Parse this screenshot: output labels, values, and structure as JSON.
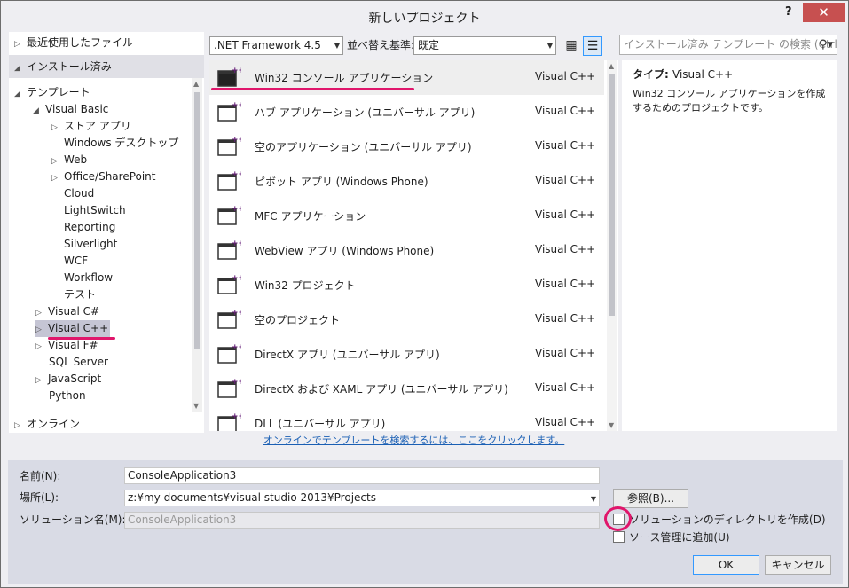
{
  "window": {
    "title": "新しいプロジェクト",
    "help": "?",
    "close": "✕"
  },
  "left_panel": {
    "recent": "最近使用したファイル",
    "installed": "インストール済み",
    "online": "オンライン",
    "tree": {
      "templates": "テンプレート",
      "visual_basic": "Visual Basic",
      "vb_children": [
        "ストア アプリ",
        "Windows デスクトップ",
        "Web",
        "Office/SharePoint",
        "Cloud",
        "LightSwitch",
        "Reporting",
        "Silverlight",
        "WCF",
        "Workflow",
        "テスト"
      ],
      "visual_csharp": "Visual C#",
      "visual_cpp": "Visual C++",
      "visual_fsharp": "Visual F#",
      "sql_server": "SQL Server",
      "javascript": "JavaScript",
      "python": "Python"
    }
  },
  "toolbar": {
    "framework": ".NET Framework 4.5",
    "sort_label": "並べ替え基準:",
    "sort_value": "既定",
    "search_placeholder": "インストール済み テンプレート の検索 (Ctrl"
  },
  "templates": [
    {
      "name": "Win32 コンソール アプリケーション",
      "lang": "Visual C++",
      "icon": "console-app-icon",
      "selected": true
    },
    {
      "name": "ハブ アプリケーション (ユニバーサル アプリ)",
      "lang": "Visual C++",
      "icon": "hub-app-icon"
    },
    {
      "name": "空のアプリケーション (ユニバーサル アプリ)",
      "lang": "Visual C++",
      "icon": "blank-app-icon"
    },
    {
      "name": "ピボット アプリ (Windows Phone)",
      "lang": "Visual C++",
      "icon": "pivot-app-icon"
    },
    {
      "name": "MFC アプリケーション",
      "lang": "Visual C++",
      "icon": "mfc-app-icon"
    },
    {
      "name": "WebView アプリ (Windows Phone)",
      "lang": "Visual C++",
      "icon": "webview-app-icon"
    },
    {
      "name": "Win32 プロジェクト",
      "lang": "Visual C++",
      "icon": "win32-project-icon"
    },
    {
      "name": "空のプロジェクト",
      "lang": "Visual C++",
      "icon": "empty-project-icon"
    },
    {
      "name": "DirectX アプリ (ユニバーサル アプリ)",
      "lang": "Visual C++",
      "icon": "directx-app-icon"
    },
    {
      "name": "DirectX および XAML アプリ (ユニバーサル アプリ)",
      "lang": "Visual C++",
      "icon": "directx-xaml-app-icon"
    },
    {
      "name": "DLL (ユニバーサル アプリ)",
      "lang": "Visual C++",
      "icon": "dll-icon"
    }
  ],
  "online_link": "オンラインでテンプレートを検索するには、ここをクリックします。",
  "info": {
    "type_label": "タイプ:",
    "type_value": "Visual C++",
    "description": "Win32 コンソール アプリケーションを作成するためのプロジェクトです。"
  },
  "form": {
    "name_label": "名前(N):",
    "name_value": "ConsoleApplication3",
    "location_label": "場所(L):",
    "location_value": "z:¥my documents¥visual studio 2013¥Projects",
    "browse": "参照(B)...",
    "solution_label": "ソリューション名(M):",
    "solution_value": "ConsoleApplication3",
    "create_dir": "ソリューションのディレクトリを作成(D)",
    "source_control": "ソース管理に追加(U)",
    "ok": "OK",
    "cancel": "キャンセル"
  },
  "colors": {
    "accent": "#68217a",
    "highlight": "#e0166b",
    "close": "#c75050",
    "link": "#1a5fb4"
  }
}
